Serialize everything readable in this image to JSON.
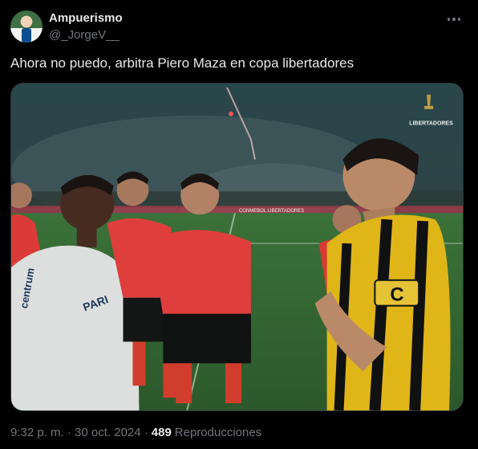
{
  "author": {
    "display_name": "Ampuerismo",
    "handle": "@_JorgeV__"
  },
  "tweet": {
    "text": "Ahora no puedo, arbitra Piero Maza en copa libertadores"
  },
  "media": {
    "overlay_logo_text": "LIBERTADORES",
    "banner_text": "CONMEBOL LIBERTADORES",
    "jersey_sponsor_text": "centrum",
    "jersey_sponsor_text_2": "PARI",
    "captain_letter": "C"
  },
  "meta": {
    "timestamp": "9:32 p. m. · 30 oct. 2024 ·",
    "views_count": "489",
    "views_label": "Reproducciones"
  },
  "colors": {
    "background": "#000000",
    "text_primary": "#e7e9ea",
    "text_secondary": "#71767b",
    "referee_shirt": "#f0423f",
    "yellow_jersey": "#f2c318"
  }
}
